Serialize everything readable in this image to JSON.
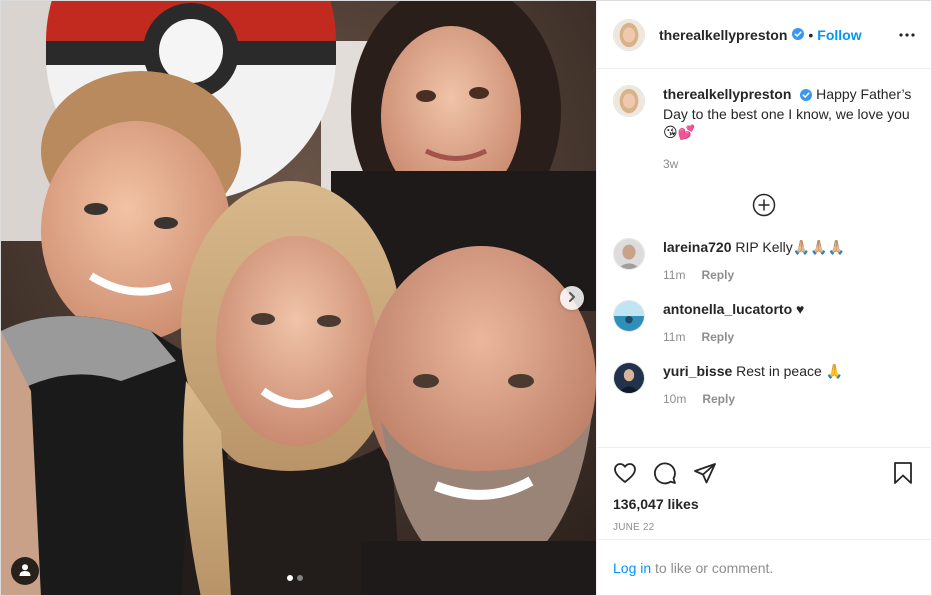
{
  "post": {
    "username": "therealkellypreston",
    "follow_label": "Follow",
    "bullet": "•",
    "caption": "Happy Father’s Day to the best one I know, we love you 😘💕",
    "caption_age": "3w",
    "likes": "136,047 likes",
    "date": "JUNE 22"
  },
  "carousel": {
    "slide_count": 2,
    "active_slide": 1
  },
  "comments": [
    {
      "username": "lareina720",
      "text": "RIP Kelly🙏🏼🙏🏼🙏🏼",
      "age": "11m",
      "reply_label": "Reply"
    },
    {
      "username": "antonella_lucatorto",
      "text": "♥",
      "age": "11m",
      "reply_label": "Reply"
    },
    {
      "username": "yuri_bisse",
      "text": "Rest in peace 🙏",
      "age": "10m",
      "reply_label": "Reply"
    }
  ],
  "footer": {
    "login_link": "Log in",
    "login_text": " to like or comment."
  },
  "icons": {
    "verified": "verified-badge-icon",
    "more": "more-options-icon",
    "load_more": "load-more-comments-icon",
    "like": "heart-icon",
    "comment": "comment-icon",
    "share": "share-icon",
    "save": "bookmark-icon",
    "next": "chevron-right-icon",
    "tags": "user-tag-icon"
  },
  "colors": {
    "link": "#0095f6",
    "verified": "#3897f0",
    "muted": "#8e8e8e",
    "text": "#262626"
  }
}
